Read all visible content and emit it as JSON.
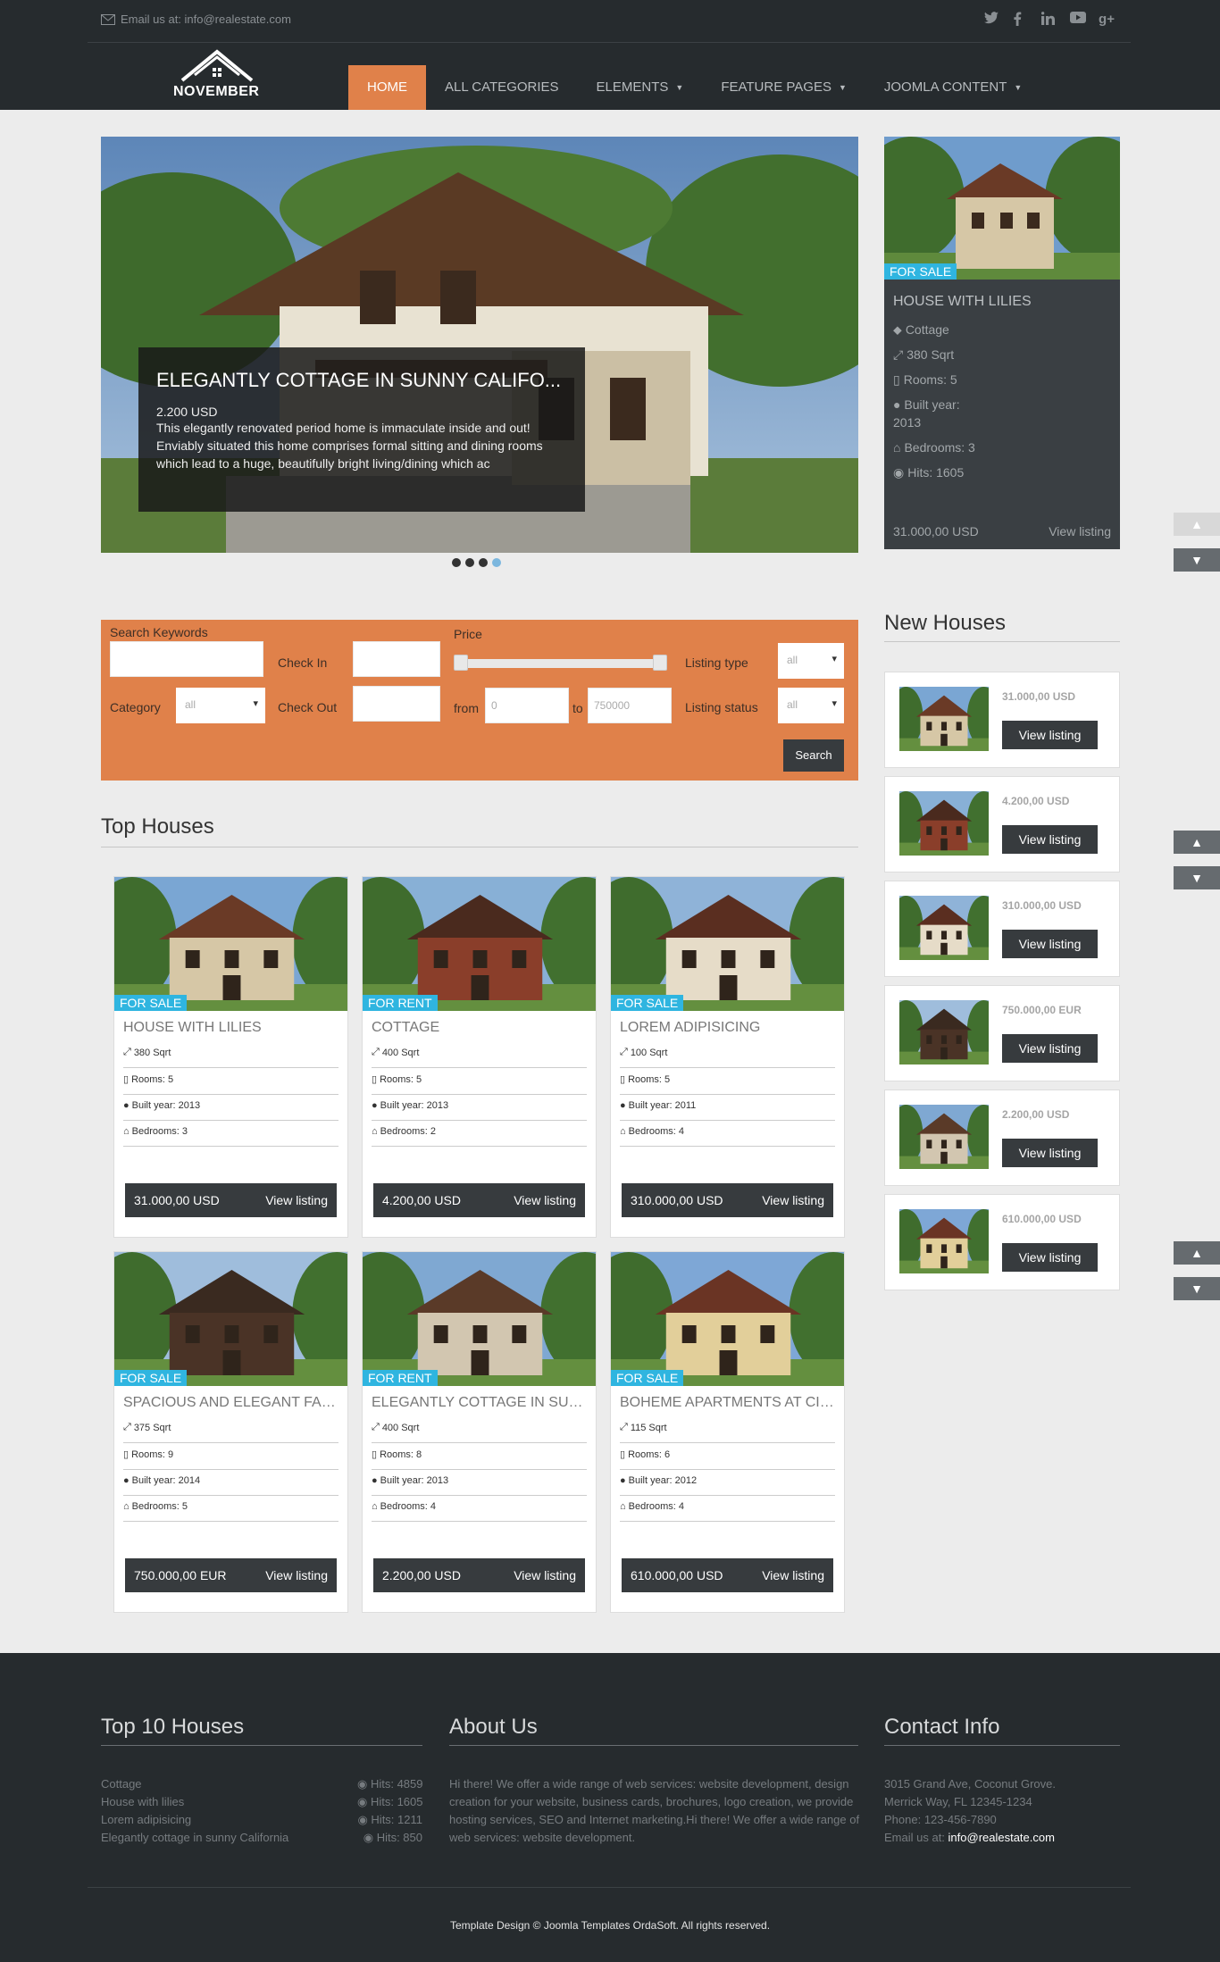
{
  "header": {
    "email_label": "Email us at: info@realestate.com",
    "social_icons": [
      "twitter-icon",
      "facebook-icon",
      "linkedin-icon",
      "youtube-icon",
      "google-plus-icon"
    ],
    "logo_text": "NOVEMBER",
    "nav": [
      {
        "label": "HOME",
        "active": true,
        "dropdown": false
      },
      {
        "label": "ALL CATEGORIES",
        "active": false,
        "dropdown": false
      },
      {
        "label": "ELEMENTS",
        "active": false,
        "dropdown": true
      },
      {
        "label": "FEATURE PAGES",
        "active": false,
        "dropdown": true
      },
      {
        "label": "JOOMLA CONTENT",
        "active": false,
        "dropdown": true
      }
    ]
  },
  "hero": {
    "title": "ELEGANTLY COTTAGE IN SUNNY CALIFO...",
    "price": "2.200 USD",
    "description": "This elegantly renovated period home is immaculate inside and out! Enviably situated this home comprises formal sitting and dining rooms which lead to a huge, beautifully bright living/dining which ac",
    "slides": 4,
    "active_slide": 4
  },
  "side_listing": {
    "badge": "FOR SALE",
    "title": "HOUSE WITH LILIES",
    "category": "Cottage",
    "area": "380 Sqrt",
    "rooms": "Rooms: 5",
    "built_label": "Built year:",
    "built_year": "2013",
    "bedrooms": "Bedrooms: 3",
    "hits": "Hits: 1605",
    "price": "31.000,00 USD",
    "view_label": "View listing"
  },
  "search": {
    "keywords_label": "Search Keywords",
    "keywords_value": "",
    "category_label": "Category",
    "category_value": "all",
    "checkin_label": "Check In",
    "checkout_label": "Check Out",
    "price_label": "Price",
    "price_min": 0,
    "price_max": 750000,
    "from_label": "from",
    "from_placeholder": "0",
    "to_label": "to",
    "to_placeholder": "750000",
    "listing_type_label": "Listing type",
    "listing_type_value": "all",
    "listing_status_label": "Listing status",
    "listing_status_value": "all",
    "search_button": "Search"
  },
  "top_houses": {
    "title": "Top Houses",
    "items": [
      {
        "badge": "FOR SALE",
        "title": "HOUSE WITH LILIES",
        "area": "380 Sqrt",
        "rooms": "Rooms: 5",
        "built": "Built year: 2013",
        "bedrooms": "Bedrooms: 3",
        "price": "31.000,00 USD",
        "view": "View listing"
      },
      {
        "badge": "FOR RENT",
        "title": "COTTAGE",
        "area": "400 Sqrt",
        "rooms": "Rooms: 5",
        "built": "Built year: 2013",
        "bedrooms": "Bedrooms: 2",
        "price": "4.200,00 USD",
        "view": "View listing"
      },
      {
        "badge": "FOR SALE",
        "title": "LOREM ADIPISICING",
        "area": "100 Sqrt",
        "rooms": "Rooms: 5",
        "built": "Built year: 2011",
        "bedrooms": "Bedrooms: 4",
        "price": "310.000,00 USD",
        "view": "View listing"
      },
      {
        "badge": "FOR SALE",
        "title": "SPACIOUS AND ELEGANT FAMI...",
        "area": "375 Sqrt",
        "rooms": "Rooms: 9",
        "built": "Built year: 2014",
        "bedrooms": "Bedrooms: 5",
        "price": "750.000,00 EUR",
        "view": "View listing"
      },
      {
        "badge": "FOR RENT",
        "title": "ELEGANTLY COTTAGE IN SUN...",
        "area": "400 Sqrt",
        "rooms": "Rooms: 8",
        "built": "Built year: 2013",
        "bedrooms": "Bedrooms: 4",
        "price": "2.200,00 USD",
        "view": "View listing"
      },
      {
        "badge": "FOR SALE",
        "title": "BOHEME APARTMENTS AT CIT...",
        "area": "115 Sqrt",
        "rooms": "Rooms: 6",
        "built": "Built year: 2012",
        "bedrooms": "Bedrooms: 4",
        "price": "610.000,00 USD",
        "view": "View listing"
      }
    ]
  },
  "new_houses": {
    "title": "New Houses",
    "items": [
      {
        "price": "31.000,00 USD",
        "view": "View listing"
      },
      {
        "price": "4.200,00 USD",
        "view": "View listing"
      },
      {
        "price": "310.000,00 USD",
        "view": "View listing"
      },
      {
        "price": "750.000,00 EUR",
        "view": "View listing"
      },
      {
        "price": "2.200,00 USD",
        "view": "View listing"
      },
      {
        "price": "610.000,00 USD",
        "view": "View listing"
      }
    ]
  },
  "footer": {
    "top10_title": "Top 10 Houses",
    "top10": [
      {
        "name": "Cottage",
        "hits": "Hits: 4859"
      },
      {
        "name": "House with lilies",
        "hits": "Hits: 1605"
      },
      {
        "name": "Lorem adipisicing",
        "hits": "Hits: 1211"
      },
      {
        "name": "Elegantly cottage in sunny California",
        "hits": "Hits: 850"
      }
    ],
    "about_title": "About Us",
    "about_text": "Hi there! We offer a wide range of web services: website development, design creation for your website, business cards, brochures, logo creation, we provide hosting services, SEO and Internet marketing.Hi there! We offer a wide range of web services: website development.",
    "contact_title": "Contact Info",
    "address1": "3015 Grand Ave, Coconut Grove.",
    "address2": "Merrick Way, FL 12345-1234",
    "phone": "Phone: 123-456-7890",
    "email_prefix": "Email us at: ",
    "email": "info@realestate.com",
    "copyright": "Template Design © Joomla Templates OrdaSoft. All rights reserved."
  },
  "colors": {
    "accent": "#e0814a",
    "badge": "#2fb5e0",
    "dark": "#262b2e",
    "button": "#373b3e"
  }
}
